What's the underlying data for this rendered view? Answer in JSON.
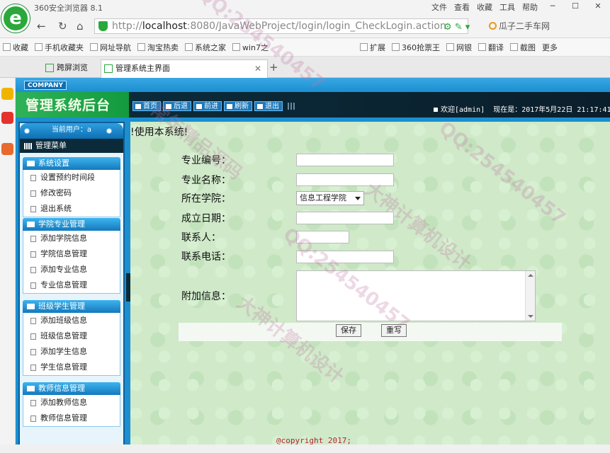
{
  "browser": {
    "title": "360安全浏览器 8.1",
    "menu": [
      "文件",
      "查看",
      "收藏",
      "工具",
      "帮助"
    ],
    "url_prefix": "http://",
    "url_host": "localhost",
    "url_rest": ":8080/JavaWebProject/login/login_CheckLogin.action",
    "search_text": "瓜子二手车网",
    "bookmarks": [
      "收藏",
      "手机收藏夹",
      "网址导航",
      "淘宝热卖",
      "系统之家",
      "win7之",
      "扩展",
      "360抢票王",
      "网银",
      "翻译",
      "截图",
      "更多"
    ],
    "tabs": {
      "split": "跨屏浏览",
      "active": "管理系统主界面"
    }
  },
  "app": {
    "company": "COMPANY",
    "title": "管理系统后台",
    "nav": [
      "首页",
      "后退",
      "前进",
      "刷新",
      "退出"
    ],
    "welcome": "欢迎[admin]",
    "date_text": "现在是：2017年5月22日 21:17:41",
    "current_user_label": "当前用户：a",
    "menu_title": "管理菜单",
    "marquee": "!使用本系统!",
    "groups": [
      {
        "title": "系统设置",
        "items": [
          "设置预约时间段",
          "修改密码",
          "退出系统"
        ]
      },
      {
        "title": "学院专业管理",
        "items": [
          "添加学院信息",
          "学院信息管理",
          "添加专业信息",
          "专业信息管理"
        ]
      },
      {
        "title": "班级学生管理",
        "items": [
          "添加班级信息",
          "班级信息管理",
          "添加学生信息",
          "学生信息管理"
        ]
      },
      {
        "title": "教师信息管理",
        "items": [
          "添加教师信息",
          "教师信息管理"
        ]
      }
    ],
    "form": {
      "labels": [
        "专业编号：",
        "专业名称：",
        "所在学院：",
        "成立日期：",
        "联系人：",
        "联系电话：",
        "附加信息："
      ],
      "college_selected": "信息工程学院",
      "save_label": "保存",
      "reset_label": "重写"
    },
    "footer": "@copyright 2017;"
  },
  "watermark": {
    "qq": "QQ:254540457",
    "brand": "大神计算机设计",
    "extra": "常年精品源码"
  }
}
